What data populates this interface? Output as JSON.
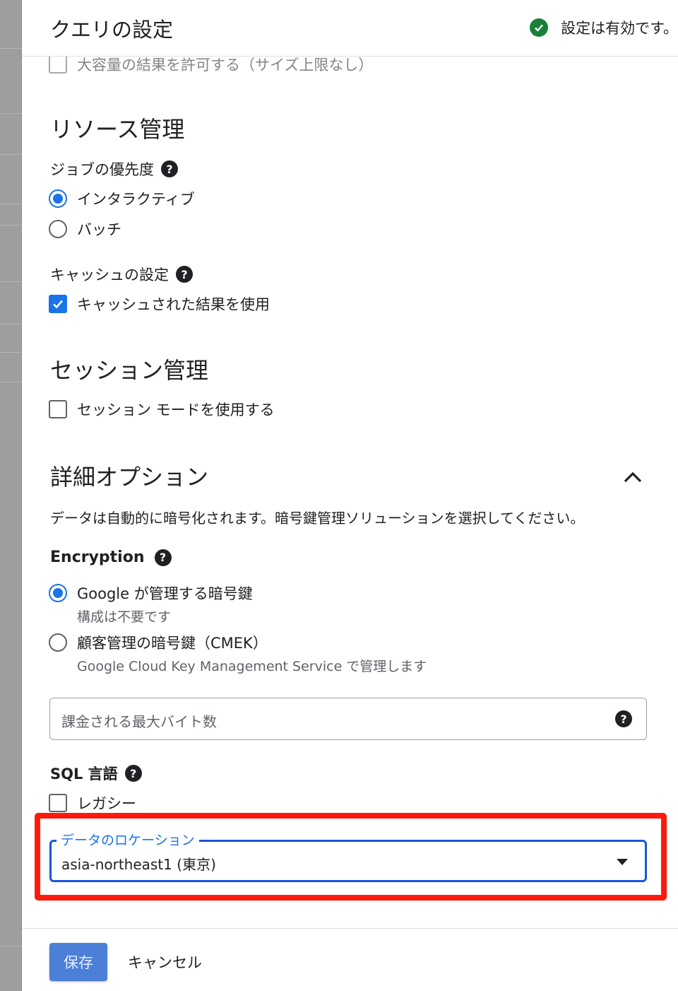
{
  "header": {
    "title": "クエリの設定",
    "status": "設定は有効です。"
  },
  "cut_option": {
    "label": "大容量の結果を許可する（サイズ上限なし）"
  },
  "resource": {
    "title": "リソース管理",
    "job_priority_label": "ジョブの優先度",
    "options": [
      "インタラクティブ",
      "バッチ"
    ],
    "cache_label": "キャッシュの設定",
    "cache_option": "キャッシュされた結果を使用"
  },
  "session": {
    "title": "セッション管理",
    "option": "セッション モードを使用する"
  },
  "advanced": {
    "title": "詳細オプション",
    "description": "データは自動的に暗号化されます。暗号鍵管理ソリューションを選択してください。",
    "encryption_label": "Encryption",
    "encryption_options": [
      {
        "label": "Google が管理する暗号鍵",
        "sub": "構成は不要です"
      },
      {
        "label": "顧客管理の暗号鍵（CMEK）",
        "sub": "Google Cloud Key Management Service で管理します"
      }
    ],
    "max_bytes_placeholder": "課金される最大バイト数",
    "sql_label": "SQL 言語",
    "sql_option": "レガシー",
    "location_label": "データのロケーション",
    "location_value": "asia-northeast1 (東京)"
  },
  "footer": {
    "save": "保存",
    "cancel": "キャンセル"
  },
  "help_glyph": "?",
  "colors": {
    "accent": "#1a73e8",
    "highlight": "#ff1a0d",
    "status_ok": "#188038"
  }
}
